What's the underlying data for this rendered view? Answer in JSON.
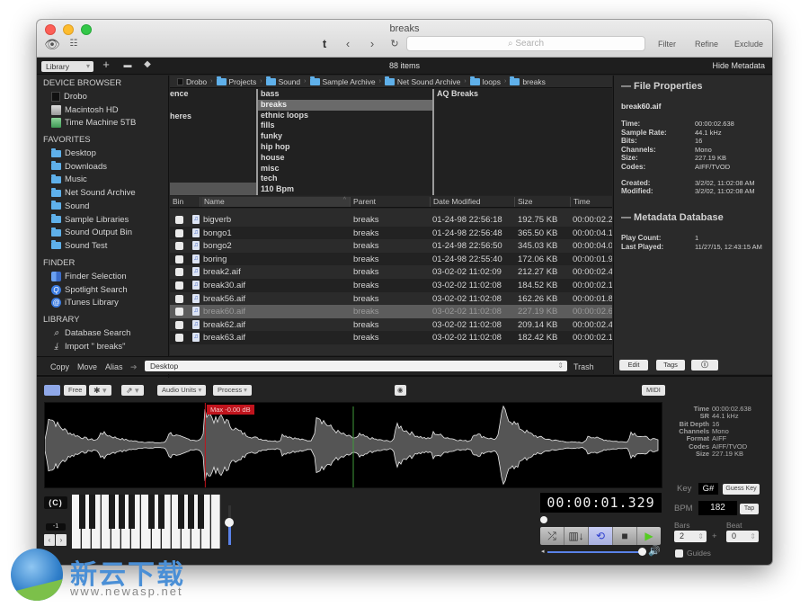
{
  "window": {
    "title": "breaks"
  },
  "toolbar": {
    "search_placeholder": "Search",
    "filter": "Filter",
    "refine": "Refine",
    "exclude": "Exclude"
  },
  "secondary_toolbar": {
    "source_select": "Library",
    "items_count": "88 items",
    "hide_metadata": "Hide Metadata"
  },
  "sidebar": {
    "sections": [
      {
        "title": "DEVICE BROWSER",
        "items": [
          {
            "label": "Drobo",
            "icon": "drive-icon"
          },
          {
            "label": "Macintosh HD",
            "icon": "hard-disk-icon"
          },
          {
            "label": "Time Machine 5TB",
            "icon": "time-machine-icon"
          }
        ]
      },
      {
        "title": "FAVORITES",
        "items": [
          {
            "label": "Desktop",
            "icon": "folder-icon"
          },
          {
            "label": "Downloads",
            "icon": "folder-icon"
          },
          {
            "label": "Music",
            "icon": "folder-icon"
          },
          {
            "label": "Net Sound Archive",
            "icon": "folder-icon"
          },
          {
            "label": "Sound",
            "icon": "folder-icon"
          },
          {
            "label": "Sample Libraries",
            "icon": "folder-icon"
          },
          {
            "label": "Sound Output Bin",
            "icon": "folder-icon"
          },
          {
            "label": "Sound Test",
            "icon": "folder-icon"
          }
        ]
      },
      {
        "title": "FINDER",
        "items": [
          {
            "label": "Finder Selection",
            "icon": "finder-icon"
          },
          {
            "label": "Spotlight Search",
            "icon": "spotlight-icon"
          },
          {
            "label": "iTunes Library",
            "icon": "itunes-icon"
          }
        ]
      },
      {
        "title": "LIBRARY",
        "items": [
          {
            "label": "Database Search",
            "icon": "search-icon"
          },
          {
            "label": "Import \" breaks\"",
            "icon": "import-icon"
          }
        ]
      }
    ]
  },
  "breadcrumb": [
    "Drobo",
    "Projects",
    "Sound",
    "Sample Archive",
    "Net Sound Archive",
    "loops",
    "breaks"
  ],
  "browser": {
    "col1": [
      "ence",
      "",
      "heres"
    ],
    "col2": [
      "bass",
      "breaks",
      "ethnic loops",
      "fills",
      "funky",
      "hip hop",
      "house",
      "misc",
      "tech",
      "110 Bpm"
    ],
    "col2_selected": "breaks",
    "col3": [
      "AQ Breaks"
    ]
  },
  "table": {
    "columns": [
      "Bin",
      "Name",
      "Parent",
      "Date Modified",
      "Size",
      "Time"
    ],
    "rows": [
      {
        "name": "bigverb",
        "parent": "breaks",
        "date": "01-24-98 22:56:18",
        "size": "192.75 KB",
        "time": "00:00:02.2"
      },
      {
        "name": "bongo1",
        "parent": "breaks",
        "date": "01-24-98 22:56:48",
        "size": "365.50 KB",
        "time": "00:00:04.1"
      },
      {
        "name": "bongo2",
        "parent": "breaks",
        "date": "01-24-98 22:56:50",
        "size": "345.03 KB",
        "time": "00:00:04.0"
      },
      {
        "name": "boring",
        "parent": "breaks",
        "date": "01-24-98 22:55:40",
        "size": "172.06 KB",
        "time": "00:00:01.9"
      },
      {
        "name": "break2.aif",
        "parent": "breaks",
        "date": "03-02-02 11:02:09",
        "size": "212.27 KB",
        "time": "00:00:02.4"
      },
      {
        "name": "break30.aif",
        "parent": "breaks",
        "date": "03-02-02 11:02:08",
        "size": "184.52 KB",
        "time": "00:00:02.1"
      },
      {
        "name": "break56.aif",
        "parent": "breaks",
        "date": "03-02-02 11:02:08",
        "size": "162.26 KB",
        "time": "00:00:01.8"
      },
      {
        "name": "break60.aif",
        "parent": "breaks",
        "date": "03-02-02 11:02:08",
        "size": "227.19 KB",
        "time": "00:00:02.6",
        "selected": true
      },
      {
        "name": "break62.aif",
        "parent": "breaks",
        "date": "03-02-02 11:02:08",
        "size": "209.14 KB",
        "time": "00:00:02.4"
      },
      {
        "name": "break63.aif",
        "parent": "breaks",
        "date": "03-02-02 11:02:08",
        "size": "182.42 KB",
        "time": "00:00:02.1"
      }
    ]
  },
  "file_actions": {
    "copy": "Copy",
    "move": "Move",
    "alias": "Alias",
    "destination": "Desktop",
    "trash": "Trash"
  },
  "metadata": {
    "file_properties_title": "— File Properties",
    "filename": "break60.aif",
    "props": [
      {
        "k": "Time:",
        "v": "00:00:02.638"
      },
      {
        "k": "Sample Rate:",
        "v": "44.1 kHz"
      },
      {
        "k": "Bits:",
        "v": "16"
      },
      {
        "k": "Channels:",
        "v": "Mono"
      },
      {
        "k": "Size:",
        "v": "227.19 KB"
      },
      {
        "k": "Codes:",
        "v": "AIFF/TVOD"
      }
    ],
    "dates": [
      {
        "k": "Created:",
        "v": "3/2/02, 11:02:08 AM"
      },
      {
        "k": "Modified:",
        "v": "3/2/02, 11:02:08 AM"
      }
    ],
    "database_title": "— Metadata Database",
    "db": [
      {
        "k": "Play Count:",
        "v": "1"
      },
      {
        "k": "Last Played:",
        "v": "11/27/15, 12:43:15 AM"
      }
    ],
    "edit": "Edit",
    "tags": "Tags"
  },
  "audio_toolbar": {
    "free": "Free",
    "audio_units": "Audio Units",
    "process": "Process",
    "midi": "MIDI"
  },
  "waveform": {
    "max_label": "Max -0.00 dB",
    "playhead_fraction": 0.5,
    "selection_fraction": 0.26
  },
  "audio_info": [
    {
      "k": "Time",
      "v": "00:00:02.638"
    },
    {
      "k": "SR",
      "v": "44.1 kHz"
    },
    {
      "k": "Bit Depth",
      "v": "16"
    },
    {
      "k": "Channels",
      "v": "Mono"
    },
    {
      "k": "Format",
      "v": "AIFF"
    },
    {
      "k": "Codes",
      "v": "AIFF/TVOD"
    },
    {
      "k": "Size",
      "v": "227.19 KB"
    }
  ],
  "piano": {
    "key_label": "(C)",
    "octave": "-1",
    "volume_fraction": 0.55
  },
  "transport": {
    "timecode": "00:00:01.329",
    "position_fraction": 0.0,
    "volume_fraction": 1.0
  },
  "rhythm": {
    "key_label": "Key",
    "key_value": "G#",
    "guess_key": "Guess Key",
    "bpm_label": "BPM",
    "bpm_value": "182",
    "tap": "Tap",
    "bars_label": "Bars",
    "bars_value": "2",
    "beat_label": "Beat",
    "beat_value": "0",
    "plus": "+",
    "guides": "Guides"
  },
  "watermark": {
    "brand": "新云下载",
    "url": "www.newasp.net"
  }
}
